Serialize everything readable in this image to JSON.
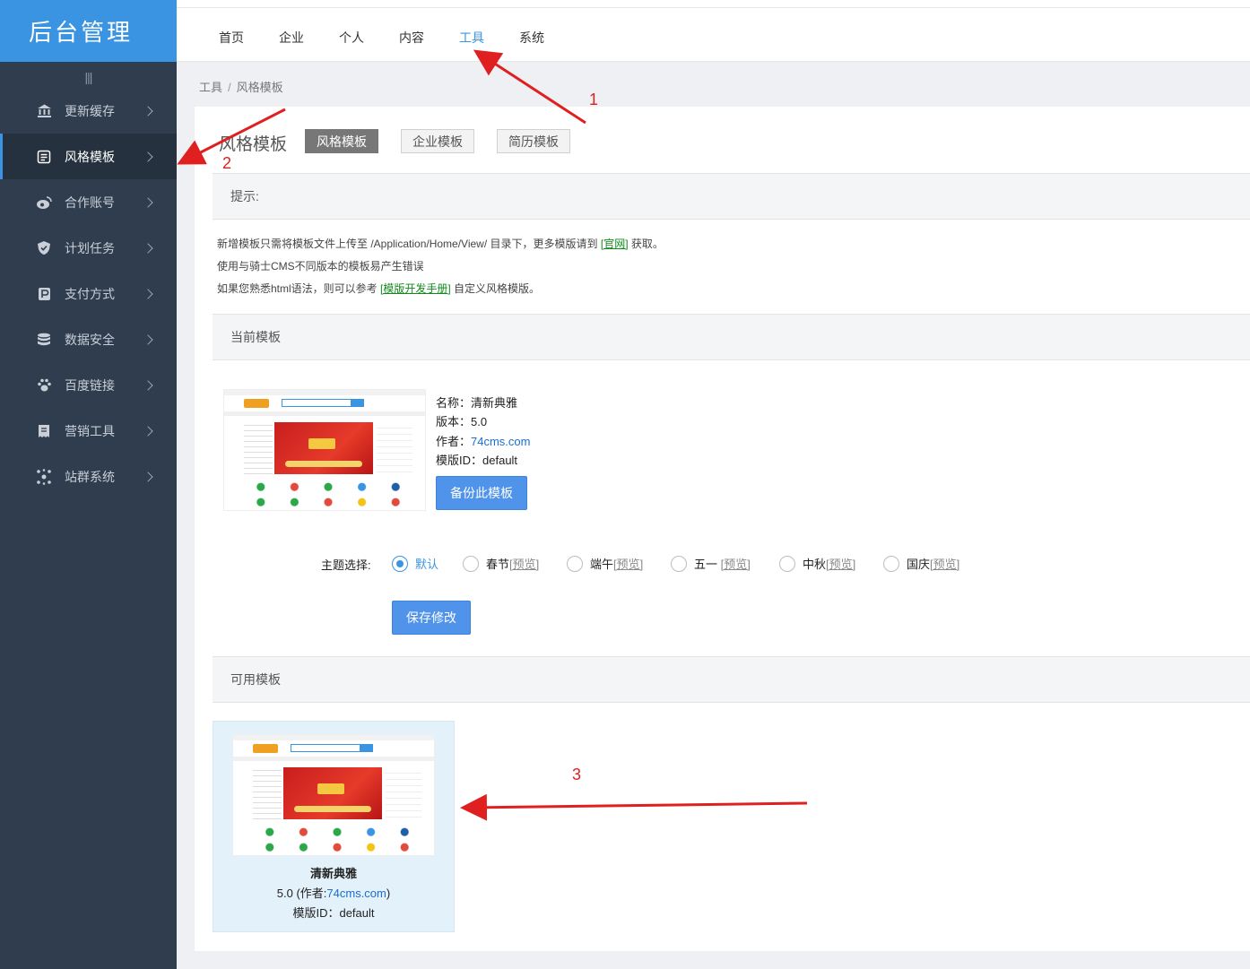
{
  "app": {
    "logo": "后台管理"
  },
  "sidebar": {
    "collapse_glyph": "|||",
    "items": [
      {
        "label": "更新缓存",
        "icon": "bank-icon"
      },
      {
        "label": "风格模板",
        "icon": "template-icon",
        "active": true
      },
      {
        "label": "合作账号",
        "icon": "weibo-icon"
      },
      {
        "label": "计划任务",
        "icon": "shield-icon"
      },
      {
        "label": "支付方式",
        "icon": "payment-icon"
      },
      {
        "label": "数据安全",
        "icon": "database-icon"
      },
      {
        "label": "百度链接",
        "icon": "paw-icon"
      },
      {
        "label": "营销工具",
        "icon": "receipt-icon"
      },
      {
        "label": "站群系统",
        "icon": "cluster-icon"
      }
    ]
  },
  "topnav": {
    "items": [
      "首页",
      "企业",
      "个人",
      "内容",
      "工具",
      "系统"
    ],
    "active": "工具"
  },
  "breadcrumb": {
    "root": "工具",
    "sep": "/",
    "current": "风格模板"
  },
  "page": {
    "title": "风格模板",
    "tabs": [
      "风格模板",
      "企业模板",
      "简历模板"
    ],
    "active_tab": "风格模板"
  },
  "tips": {
    "heading": "提示:",
    "line1_a": "新增模板只需将模板文件上传至 /Application/Home/View/ 目录下，更多模版请到 ",
    "line1_link": "[官网]",
    "line1_b": " 获取。",
    "line2": "使用与骑士CMS不同版本的模板易产生错误",
    "line3_a": "如果您熟悉html语法，则可以参考 ",
    "line3_link": "[模版开发手册]",
    "line3_b": " 自定义风格模版。"
  },
  "current": {
    "heading": "当前模板",
    "name_label": "名称：",
    "name": "清新典雅",
    "version_label": "版本：",
    "version": "5.0",
    "author_label": "作者：",
    "author": "74cms.com",
    "id_label": "模版ID：",
    "id": "default",
    "backup_button": "备份此模板"
  },
  "theme": {
    "label": "主题选择:",
    "options": [
      {
        "label": "默认",
        "preview": "",
        "checked": true
      },
      {
        "label": "春节",
        "preview": "[预览]"
      },
      {
        "label": "端午",
        "preview": "[预览]"
      },
      {
        "label": "五一 ",
        "preview": "[预览]"
      },
      {
        "label": "中秋",
        "preview": "[预览]"
      },
      {
        "label": "国庆",
        "preview": "[预览]"
      }
    ],
    "save_button": "保存修改"
  },
  "available": {
    "heading": "可用模板",
    "name": "清新典雅",
    "version_prefix": "5.0 (作者:",
    "author": "74cms.com",
    "version_suffix": ")",
    "id_text": "模版ID：default"
  },
  "annotations": {
    "n1": "1",
    "n2": "2",
    "n3": "3",
    "color": "#e02020"
  },
  "colors": {
    "accent": "#3b94e2",
    "sidebar": "#2f3d4e",
    "button": "#4f93ea"
  }
}
